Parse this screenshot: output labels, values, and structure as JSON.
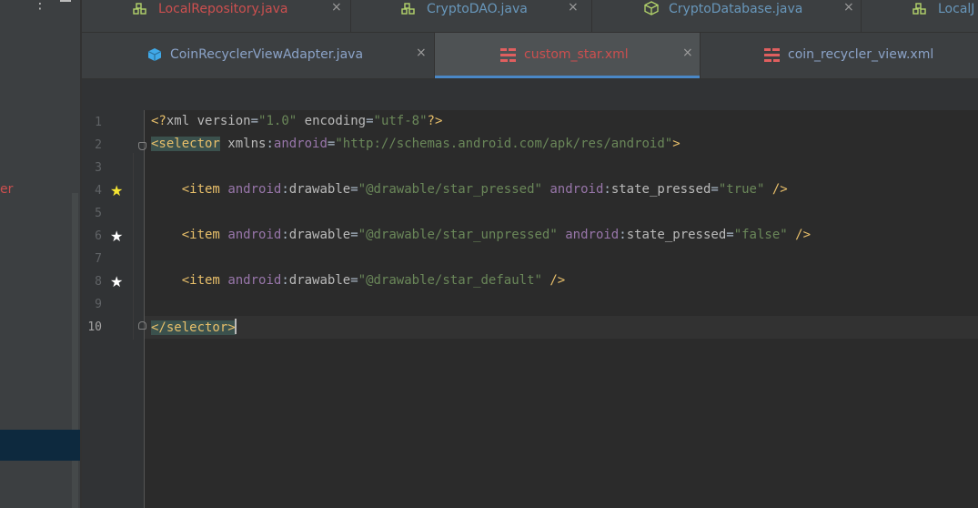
{
  "left_panel": {
    "partial_item": "er"
  },
  "tabs_row1": [
    {
      "label": "LocalRepository.java",
      "color": "#cc4f4f",
      "icon": "class-icon"
    },
    {
      "label": "CryptoDAO.java",
      "color": "#6897bb",
      "icon": "class-icon"
    },
    {
      "label": "CryptoDatabase.java",
      "color": "#6897bb",
      "icon": "cube-icon"
    },
    {
      "label": "LocalJ",
      "color": "#6897bb",
      "icon": "class-icon"
    }
  ],
  "tabs_row2": [
    {
      "label": "CoinRecyclerViewAdapter.java",
      "color": "#8ba3c8",
      "icon": "cube-icon"
    },
    {
      "label": "custom_star.xml",
      "color": "#cc4f4f",
      "icon": "xml-layout-icon",
      "active": true
    },
    {
      "label": "coin_recycler_view.xml",
      "color": "#8ba3c8",
      "icon": "xml-layout-icon"
    }
  ],
  "close_glyph": "×",
  "line_numbers": [
    "1",
    "2",
    "3",
    "4",
    "5",
    "6",
    "7",
    "8",
    "9",
    "10"
  ],
  "gutter_stars": {
    "line4": "★",
    "line6": "★",
    "line8": "★"
  },
  "code": {
    "l1": {
      "lt": "<?",
      "name": "xml",
      "a1": "version",
      "eq1": "=",
      "v1": "\"1.0\"",
      "a2": "encoding",
      "eq2": "=",
      "v2": "\"utf-8\"",
      "end": "?>"
    },
    "l2": {
      "open": "<selector",
      "attr": "xmlns",
      "colon": ":",
      "ns": "android",
      "eq": "=",
      "val": "\"http://schemas.android.com/apk/res/android\"",
      "end": ">"
    },
    "l4": {
      "tag": "<item",
      "ns1": "android",
      "c1": ":",
      "a1": "drawable",
      "eq1": "=",
      "v1": "\"@drawable/star_pressed\"",
      "ns2": "android",
      "c2": ":",
      "a2": "state_pressed",
      "eq2": "=",
      "v2": "\"true\"",
      "end": "/>"
    },
    "l6": {
      "tag": "<item",
      "ns1": "android",
      "c1": ":",
      "a1": "drawable",
      "eq1": "=",
      "v1": "\"@drawable/star_unpressed\"",
      "ns2": "android",
      "c2": ":",
      "a2": "state_pressed",
      "eq2": "=",
      "v2": "\"false\"",
      "end": "/>"
    },
    "l8": {
      "tag": "<item",
      "ns1": "android",
      "c1": ":",
      "a1": "drawable",
      "eq1": "=",
      "v1": "\"@drawable/star_default\"",
      "end": "/>"
    },
    "l10": {
      "close": "</selector",
      "end": ">"
    }
  }
}
